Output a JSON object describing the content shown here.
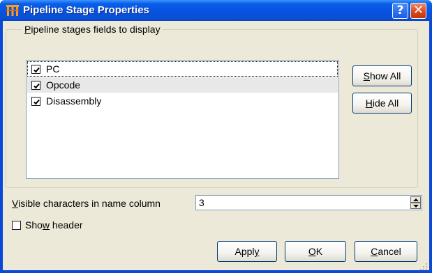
{
  "window": {
    "title": "Pipeline Stage Properties",
    "help_button": "?",
    "close_button": "✕"
  },
  "fields_group": {
    "legend_mnemonic": "P",
    "legend_rest": "ipeline stages fields to display",
    "items": [
      {
        "label": "PC",
        "checked": true
      },
      {
        "label": "Opcode",
        "checked": true
      },
      {
        "label": "Disassembly",
        "checked": true
      }
    ],
    "show_all_mnemonic": "S",
    "show_all_rest": "how All",
    "hide_all_mnemonic": "H",
    "hide_all_rest": "ide All"
  },
  "name_column": {
    "label_mnemonic": "V",
    "label_rest": "isible characters in name column",
    "value": "3"
  },
  "show_header": {
    "label_before": "Sho",
    "label_mnemonic": "w",
    "label_after": " header",
    "checked": false
  },
  "buttons": {
    "apply_before": "Appl",
    "apply_mnemonic": "y",
    "ok_mnemonic": "O",
    "ok_rest": "K",
    "cancel_mnemonic": "C",
    "cancel_rest": "ancel"
  },
  "colors": {
    "title_bar": "#0553e0",
    "dialog_face": "#ece9d8",
    "close_button": "#d8461c"
  }
}
